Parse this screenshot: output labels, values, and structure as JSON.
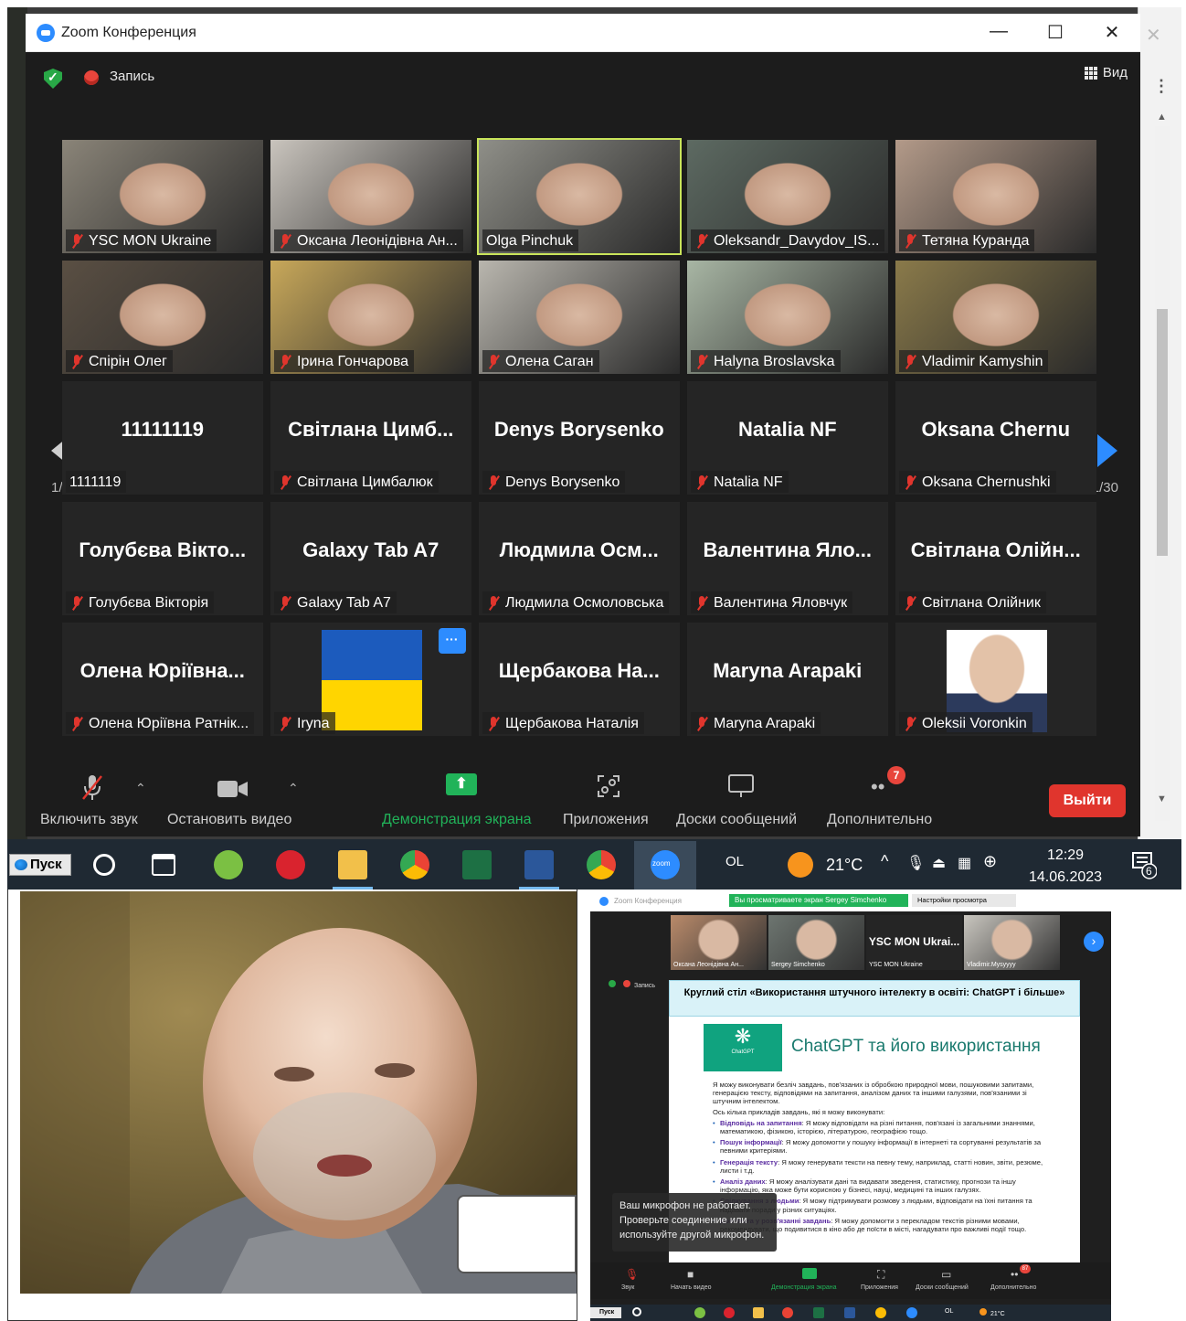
{
  "window": {
    "title": "Zoom Конференция",
    "minimize": "—",
    "maximize": "☐",
    "close": "✕"
  },
  "meeting_bar": {
    "record_label": "Запись",
    "view_label": "Вид"
  },
  "pager": {
    "left_count": "1/30",
    "right_count": "1/30"
  },
  "tiles": [
    [
      {
        "label": "YSC MON Ukraine",
        "type": "video",
        "muted": true,
        "bg": "#8a8478"
      },
      {
        "label": "Оксана Леонідівна Ан...",
        "type": "video",
        "muted": true,
        "bg": "#c9c4bd"
      },
      {
        "label": "Olga  Pinchuk",
        "type": "video",
        "muted": false,
        "active": true,
        "bg": "#8f8f88"
      },
      {
        "label": "Oleksandr_Davydov_IS...",
        "type": "video",
        "muted": true,
        "bg": "#5d6a62"
      },
      {
        "label": "Тетяна Куранда",
        "type": "video",
        "muted": true,
        "bg": "#b39a89"
      }
    ],
    [
      {
        "label": "Спірін Олег",
        "type": "video",
        "muted": true,
        "bg": "#5a4f43"
      },
      {
        "label": "Ірина Гончарова",
        "type": "video",
        "muted": true,
        "bg": "#c8a85a"
      },
      {
        "label": "Олена Саган",
        "type": "video",
        "muted": true,
        "bg": "#b9b6ae"
      },
      {
        "label": "Halyna Broslavska",
        "type": "video",
        "muted": true,
        "bg": "#a8b6a4"
      },
      {
        "label": "Vladimir Kamyshin",
        "type": "video",
        "muted": true,
        "bg": "#8a7a4a"
      }
    ],
    [
      {
        "label": "1111119",
        "big": "11111119",
        "type": "name",
        "muted": false
      },
      {
        "label": "Світлана Цимбалюк",
        "big": "Світлана Цимб...",
        "type": "name",
        "muted": true
      },
      {
        "label": "Denys Borysenko",
        "big": "Denys Borysenko",
        "type": "name",
        "muted": true
      },
      {
        "label": "Natalia NF",
        "big": "Natalia NF",
        "type": "name",
        "muted": true
      },
      {
        "label": "Oksana Chernushki",
        "big": "Oksana  Chernu",
        "type": "name",
        "muted": true
      }
    ],
    [
      {
        "label": "Голубєва Вікторія",
        "big": "Голубєва Вікто...",
        "type": "name",
        "muted": true
      },
      {
        "label": "Galaxy Tab A7",
        "big": "Galaxy Tab A7",
        "type": "name",
        "muted": true
      },
      {
        "label": "Людмила Осмоловська",
        "big": "Людмила Осм...",
        "type": "name",
        "muted": true
      },
      {
        "label": "Валентина Яловчук",
        "big": "Валентина Яло...",
        "type": "name",
        "muted": true
      },
      {
        "label": "Світлана Олійник",
        "big": "Світлана Олійн...",
        "type": "name",
        "muted": true
      }
    ],
    [
      {
        "label": "Олена Юріївна Ратнік...",
        "big": "Олена Юріївна...",
        "type": "name",
        "muted": true
      },
      {
        "label": "Iryna",
        "type": "flag",
        "muted": true,
        "more": "···"
      },
      {
        "label": "Щербакова Наталія",
        "big": "Щербакова На...",
        "type": "name",
        "muted": true
      },
      {
        "label": "Maryna Arapaki",
        "big": "Maryna Arapaki",
        "type": "name",
        "muted": true
      },
      {
        "label": "Oleksii Voronkin",
        "type": "portrait",
        "muted": true
      }
    ]
  ],
  "toolbar": {
    "unmute": "Включить звук",
    "stop_video": "Остановить видео",
    "share": "Демонстрация экрана",
    "apps": "Приложения",
    "whiteboards": "Доски сообщений",
    "more": "Дополнительно",
    "more_badge": "7",
    "leave": "Выйти"
  },
  "taskbar": {
    "start": "Пуск",
    "lang": "OL",
    "weather": "21°C",
    "time": "12:29",
    "date": "14.06.2023",
    "notif_count": "6",
    "zoom_label": "zoom"
  },
  "right_shot": {
    "title": "Zoom Конференция",
    "share_banner": "Вы просматриваете экран Sergey Simchenko",
    "view_settings": "Настройки просмотра",
    "thumbs": [
      {
        "name": "Оксана Леонідівна Ан...",
        "type": "video",
        "bg": "#b98a6a"
      },
      {
        "name": "Sergey Simchenko",
        "type": "video",
        "bg": "#6d7570"
      },
      {
        "name": "YSC MON Ukraine",
        "big": "YSC MON Ukrai...",
        "type": "name"
      },
      {
        "name": "Vladimir.Mysyyyy",
        "type": "video",
        "bg": "#c9c6bf"
      }
    ],
    "record": "Запись",
    "slide_heading": "Круглий стіл «Використання штучного інтелекту в освіті: ChatGPT і більше»",
    "slide_logo": "ChatGPT",
    "slide_title": "ChatGPT  та його використання",
    "slide_intro": "Я можу виконувати безліч завдань, пов'язаних із обробкою природної мови, пошуковими запитами, генерацією тексту, відповідями на запитання, аналізом даних та іншими галузями, пов'язаними зі штучним інтелектом.",
    "slide_lead": "Ось кілька прикладів завдань, які я можу виконувати:",
    "slide_items": [
      {
        "head": "Відповідь на запитання",
        "text": ": Я можу відповідати на різні питання, пов'язані із загальними знаннями, математикою, фізикою, історією, літературою, географією тощо."
      },
      {
        "head": "Пошук інформації",
        "text": ": Я можу допомогти у пошуку інформації в інтернеті та сортуванні результатів за певними критеріями."
      },
      {
        "head": "Генерація тексту",
        "text": ": Я можу генерувати тексти на певну тему, наприклад, статті новин, звіти, резюме, листи і т.д."
      },
      {
        "head": "Аналіз даних",
        "text": ": Я можу аналізувати дані та видавати зведення, статистику, прогнози та іншу інформацію, яка може бути корисною у бізнесі, науці, медицині та інших галузях."
      },
      {
        "head": "Спілкування з людьми",
        "text": ": Я можу підтримувати розмову з людьми, відповідати на їхні питання та надавати поради у різних ситуаціях."
      },
      {
        "head": "Допомога у розв'язанні завдань",
        "text": ": Я можу допомогти з перекладом текстів різними мовами, рекомендувати, що подивитися в кіно або де поїсти в місті, нагадувати про важливі події тощо."
      }
    ],
    "mic_tip": "Ваш микрофон не работает. Проверьте соединение или используйте другой микрофон.",
    "tb": {
      "sound": "Звук",
      "video": "Начать видео",
      "share": "Демонстрация экрана",
      "apps": "Приложения",
      "boards": "Доски сообщений",
      "more": "Дополнительно",
      "badge": "87"
    },
    "task": {
      "start": "Пуск",
      "lang": "OL",
      "weather": "21°C"
    }
  },
  "colors": {
    "zoom_blue": "#2d8cff",
    "share_green": "#21b359",
    "leave_red": "#e0352d",
    "active_speaker": "#c9e45a"
  }
}
